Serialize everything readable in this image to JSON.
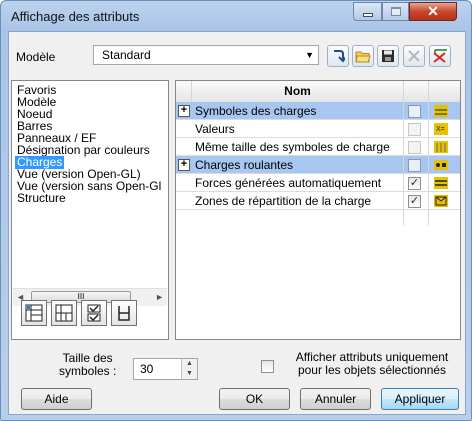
{
  "window": {
    "title": "Affichage des attributs",
    "controls": {
      "minimize": "–",
      "maximize": "□",
      "close": "✕"
    }
  },
  "model": {
    "label": "Modèle",
    "selected": "Standard",
    "dropdown_icon": "chevron-down-icon"
  },
  "toolbar": {
    "icons": [
      "import-arrow-icon",
      "open-folder-icon",
      "save-disk-icon",
      "delete-x-icon",
      "delete-all-icon"
    ]
  },
  "tree": {
    "items": [
      {
        "label": "Favoris",
        "selected": false
      },
      {
        "label": "Modèle",
        "selected": false
      },
      {
        "label": "Noeud",
        "selected": false
      },
      {
        "label": "Barres",
        "selected": false
      },
      {
        "label": "Panneaux / EF",
        "selected": false
      },
      {
        "label": "Désignation par couleurs",
        "selected": false
      },
      {
        "label": "Charges",
        "selected": true
      },
      {
        "label": "Vue (version Open-GL)",
        "selected": false
      },
      {
        "label": "Vue (version sans Open-Gl",
        "selected": false
      },
      {
        "label": "Structure",
        "selected": false
      }
    ],
    "scroll_thumb": "III"
  },
  "tree_tools": [
    "expand-all-icon",
    "collapse-all-icon",
    "check-all-icon",
    "uncheck-all-icon"
  ],
  "grid": {
    "column_header": "Nom",
    "rows": [
      {
        "label": "Symboles des charges",
        "group": true,
        "checked": "blank",
        "icon": "load-symbol-icon",
        "color": "#e0c400"
      },
      {
        "label": "Valeurs",
        "group": false,
        "checked": "disabled",
        "icon": "values-icon",
        "color": "#e6c200"
      },
      {
        "label": "Même taille des symboles de charge",
        "group": false,
        "checked": "disabled",
        "icon": "same-size-icon",
        "color": "#e6c200"
      },
      {
        "label": "Charges roulantes",
        "group": true,
        "checked": "blank",
        "icon": "moving-load-icon",
        "color": "#e6c200"
      },
      {
        "label": "Forces générées automatiquement",
        "group": false,
        "checked": "checked",
        "icon": "auto-forces-icon",
        "color": "#e6c200"
      },
      {
        "label": "Zones de répartition de la charge",
        "group": false,
        "checked": "checked",
        "icon": "distribution-zone-icon",
        "color": "#e6c200"
      }
    ]
  },
  "symbol_size": {
    "label": "Taille des symboles :",
    "label_line1": "Taille des",
    "label_line2": "symboles :",
    "value": "30"
  },
  "selected_only": {
    "line1": "Afficher attributs uniquement",
    "line2": "pour les objets sélectionnés",
    "checked": false
  },
  "buttons": {
    "help": "Aide",
    "ok": "OK",
    "cancel": "Annuler",
    "apply": "Appliquer"
  }
}
